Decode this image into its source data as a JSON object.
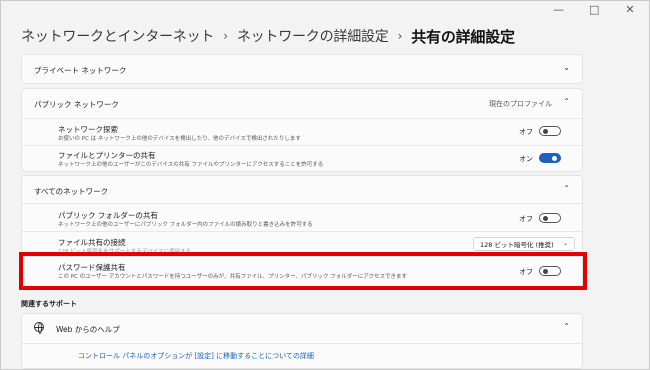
{
  "breadcrumb": {
    "level1": "ネットワークとインターネット",
    "level2": "ネットワークの詳細設定",
    "current": "共有の詳細設定",
    "separator": "›"
  },
  "window_controls": {
    "minimize": "—",
    "maximize": "□",
    "close": "✕"
  },
  "private_section": {
    "title": "プライベート ネットワーク",
    "chevron": "⌄"
  },
  "public_section": {
    "title": "パブリック ネットワーク",
    "badge": "現在のプロファイル",
    "chevron": "⌃",
    "items": [
      {
        "title": "ネットワーク探索",
        "description": "お使いの PC は ネットワーク上の他のデバイスを検出したり、他のデバイスで検出されたりします",
        "toggle_label": "オフ",
        "state": "off"
      },
      {
        "title": "ファイルとプリンターの共有",
        "description": "ネットワーク上の他のユーザーがこのデバイスの共有 ファイルやプリンターにアクセスすることを許可する",
        "toggle_label": "オン",
        "state": "on"
      }
    ]
  },
  "all_networks_section": {
    "title": "すべてのネットワーク",
    "chevron": "⌃",
    "public_folder": {
      "title": "パブリック フォルダーの共有",
      "description": "ネットワーク上の他のユーザーにパブリック フォルダー内のファイルの読み取りと書き込みを許可する",
      "toggle_label": "オフ",
      "state": "off"
    },
    "file_sharing_connections": {
      "title": "ファイル共有の接続",
      "description": "128 ビット暗号化をサポートするデバイスに使用する",
      "dropdown_value": "128 ビット暗号化 (推奨)",
      "dropdown_chevron": "⌄"
    },
    "password_protected": {
      "title": "パスワード保護共有",
      "description": "この PC のユーザー アカウントとパスワードを持つユーザーのみが、共有ファイル、プリンター、パブリック フォルダーにアクセスできます",
      "toggle_label": "オフ",
      "state": "off"
    }
  },
  "support": {
    "header": "関連するサポート",
    "help_title": "Web からのヘルプ",
    "chevron": "⌃",
    "link": "コントロール パネルのオプションが [設定] に移動することについての詳細"
  },
  "colors": {
    "highlight": "#e10000",
    "toggle_on": "#1f5fbf",
    "link": "#1560bd"
  }
}
